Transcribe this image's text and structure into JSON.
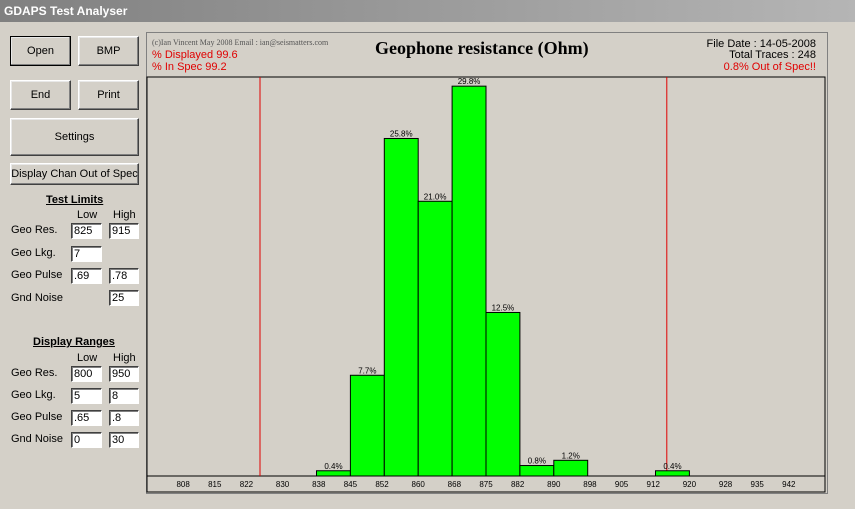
{
  "window": {
    "title": "GDAPS Test Analyser"
  },
  "buttons": {
    "open": "Open",
    "bmp": "BMP",
    "end": "End",
    "print": "Print",
    "settings": "Settings",
    "display_out_of_spec": "Display Chan Out of Spec"
  },
  "test_limits": {
    "header": "Test Limits",
    "low_label": "Low",
    "high_label": "High",
    "geo_res": {
      "label": "Geo Res.",
      "low": "825",
      "high": "915"
    },
    "geo_lkg": {
      "label": "Geo Lkg.",
      "low": "7"
    },
    "geo_pulse": {
      "label": "Geo Pulse",
      "low": ".69",
      "high": ".78"
    },
    "gnd_noise": {
      "label": "Gnd Noise",
      "high": "25"
    }
  },
  "display_ranges": {
    "header": "Display Ranges",
    "low_label": "Low",
    "high_label": "High",
    "geo_res": {
      "label": "Geo Res.",
      "low": "800",
      "high": "950"
    },
    "geo_lkg": {
      "label": "Geo Lkg.",
      "low": "5",
      "high": "8"
    },
    "geo_pulse": {
      "label": "Geo Pulse",
      "low": ".65",
      "high": ".8"
    },
    "gnd_noise": {
      "label": "Gnd Noise",
      "low": "0",
      "high": "30"
    }
  },
  "chart_info": {
    "credit": "(c)Ian Vincent May 2008 Email : ian@seismatters.com",
    "pct_displayed": "% Displayed 99.6",
    "pct_in_spec": "% In Spec 99.2",
    "file_date": "File Date : 14-05-2008",
    "total_traces": "Total Traces : 248",
    "out_of_spec": "0.8% Out of Spec!!"
  },
  "colors": {
    "bar": "#00ff00",
    "limit_line": "#e00000",
    "warning_text": "#e00000"
  },
  "chart_data": {
    "type": "bar",
    "title": "Geophone resistance (Ohm)",
    "xlabel": "",
    "ylabel": "",
    "x_ticks": [
      "808",
      "815",
      "822",
      "830",
      "838",
      "845",
      "852",
      "860",
      "868",
      "875",
      "882",
      "890",
      "898",
      "905",
      "912",
      "920",
      "928",
      "935",
      "942"
    ],
    "xlim": [
      800,
      950
    ],
    "ylim": [
      0,
      30.5
    ],
    "bin_width": 7.5,
    "bars": [
      {
        "start": 837.5,
        "value": 0.4,
        "label": "0.4%"
      },
      {
        "start": 845,
        "value": 7.7,
        "label": "7.7%"
      },
      {
        "start": 852.5,
        "value": 25.8,
        "label": "25.8%"
      },
      {
        "start": 860,
        "value": 21.0,
        "label": "21.0%"
      },
      {
        "start": 867.5,
        "value": 29.8,
        "label": "29.8%"
      },
      {
        "start": 875,
        "value": 12.5,
        "label": "12.5%"
      },
      {
        "start": 882.5,
        "value": 0.8,
        "label": "0.8%"
      },
      {
        "start": 890,
        "value": 1.2,
        "label": "1.2%"
      },
      {
        "start": 912.5,
        "value": 0.4,
        "label": "0.4%"
      }
    ],
    "limits": [
      825,
      915
    ]
  }
}
